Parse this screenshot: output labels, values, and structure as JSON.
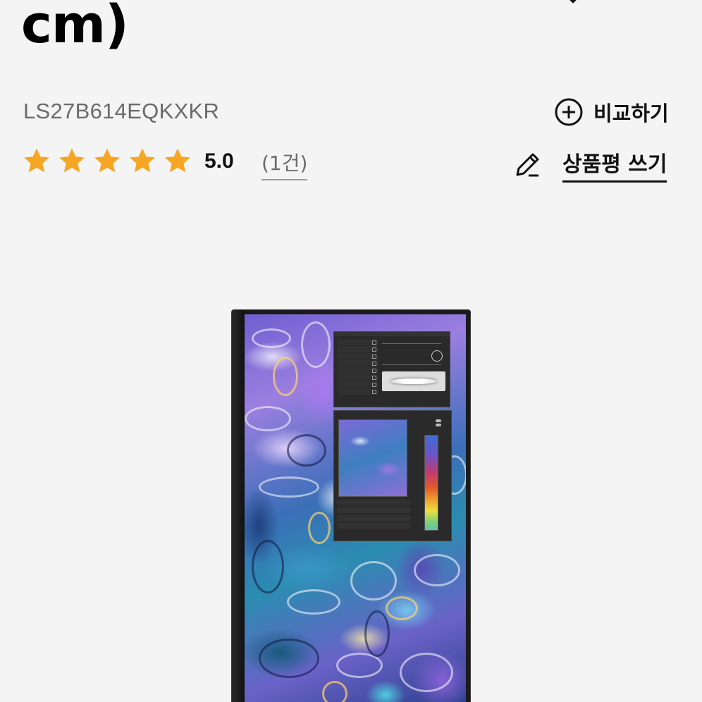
{
  "product": {
    "title_fragment": "cm)",
    "model_code": "LS27B614EQKXKR"
  },
  "rating": {
    "stars": 5,
    "value": "5.0",
    "review_count_label": "(1건)",
    "star_color": "#F5A623"
  },
  "actions": {
    "compare_label": "비교하기",
    "write_review_label": "상품평 쓰기"
  },
  "icons": {
    "compare": "plus-circle-icon",
    "write_review": "pencil-icon",
    "rating_star": "star-icon",
    "top": "chevron-icon"
  }
}
